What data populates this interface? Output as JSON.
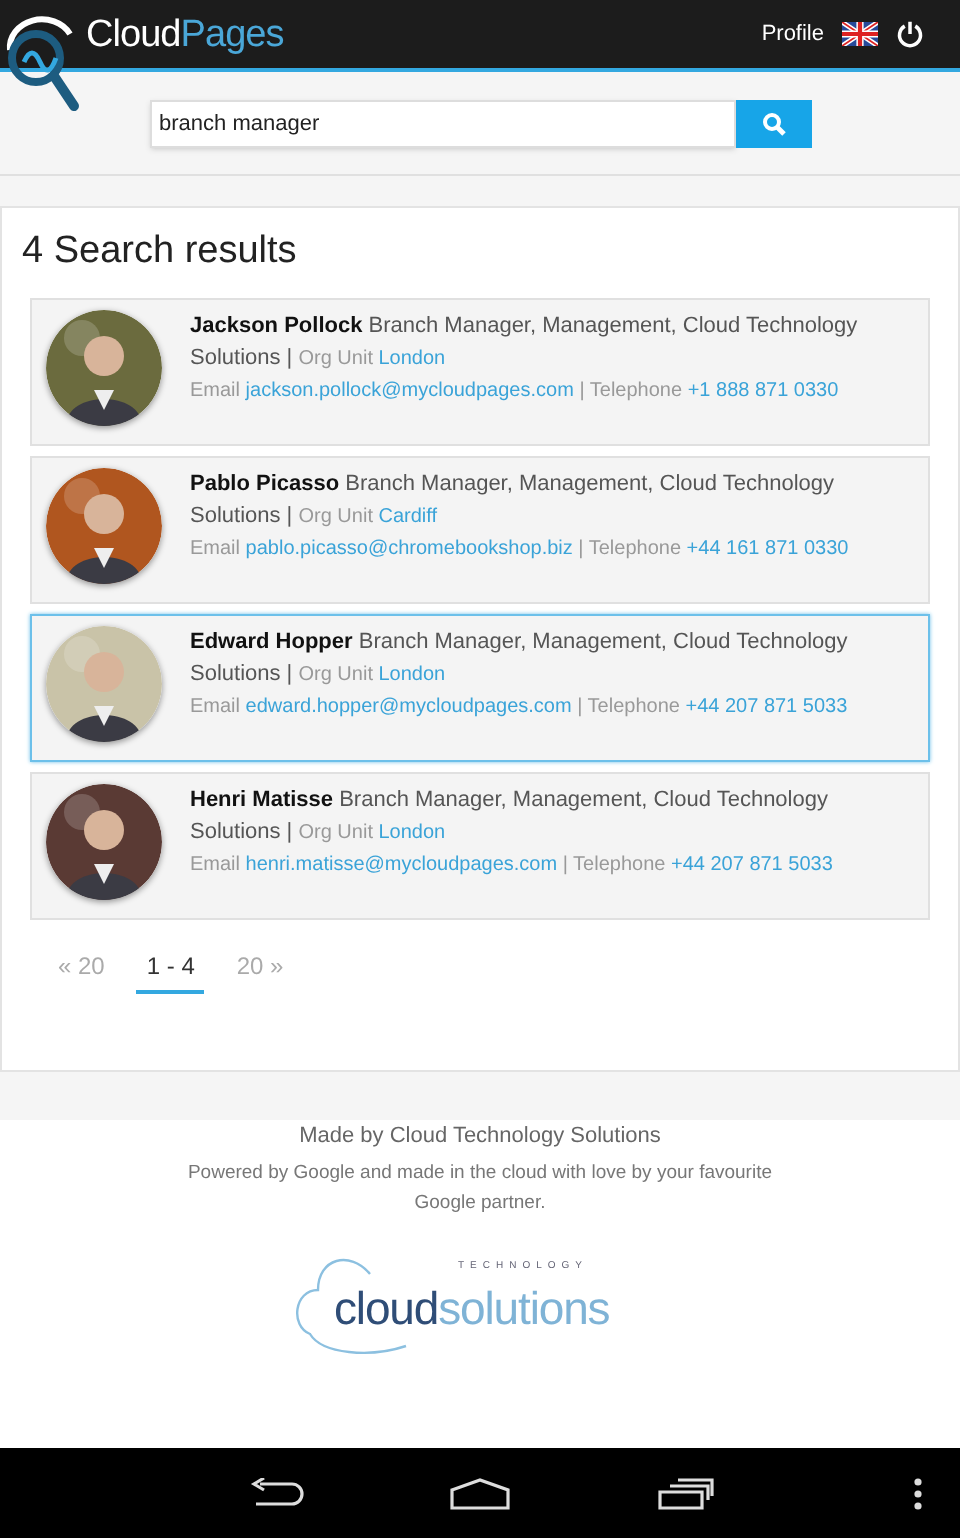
{
  "header": {
    "logo": {
      "part_1": "Cloud",
      "part_2": "Pages"
    },
    "profile": "Profile"
  },
  "search": {
    "value": "branch manager"
  },
  "results": {
    "heading": "4 Search results",
    "items": [
      {
        "name": "Jackson Pollock",
        "title": "Branch Manager, Management, Cloud Technology Solutions",
        "org_unit_label": "Org Unit",
        "org_unit": "London",
        "email_label": "Email",
        "email": "jackson.pollock@mycloudpages.com",
        "phone_label": "Telephone",
        "phone": "+1 888 871 0330",
        "separator": "|",
        "selected": false,
        "color": "#6b6b3e"
      },
      {
        "name": "Pablo Picasso",
        "title": "Branch Manager, Management, Cloud Technology Solutions",
        "org_unit_label": "Org Unit",
        "org_unit": "Cardiff",
        "email_label": "Email",
        "email": "pablo.picasso@chromebookshop.biz",
        "phone_label": "Telephone",
        "phone": "+44 161 871 0330",
        "separator": "|",
        "selected": false,
        "color": "#b0561f"
      },
      {
        "name": "Edward Hopper",
        "title": "Branch Manager, Management, Cloud Technology Solutions",
        "org_unit_label": "Org Unit",
        "org_unit": "London",
        "email_label": "Email",
        "email": "edward.hopper@mycloudpages.com",
        "phone_label": "Telephone",
        "phone": "+44 207 871 5033",
        "separator": "|",
        "selected": true,
        "color": "#c9c3a8"
      },
      {
        "name": "Henri Matisse",
        "title": "Branch Manager, Management, Cloud Technology Solutions",
        "org_unit_label": "Org Unit",
        "org_unit": "London",
        "email_label": "Email",
        "email": "henri.matisse@mycloudpages.com",
        "phone_label": "Telephone",
        "phone": "+44 207 871 5033",
        "separator": "|",
        "selected": false,
        "color": "#5a3a34"
      }
    ],
    "pagination": [
      {
        "label": "« 20",
        "selected": false
      },
      {
        "label": "1 - 4",
        "selected": true
      },
      {
        "label": "20 »",
        "selected": false
      }
    ]
  },
  "footer": {
    "made_by": "Made by Cloud Technology Solutions",
    "powered_by": "Powered by Google and made in the cloud with love by your favourite Google partner.",
    "logo": {
      "part_1": "cloud",
      "part_2": "solutions",
      "tagline": "TECHNOLOGY"
    }
  }
}
